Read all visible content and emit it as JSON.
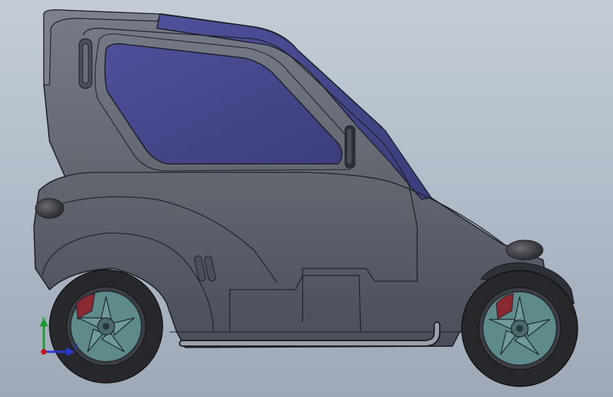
{
  "viewport": {
    "model": "electric-microcar-side-view",
    "background": {
      "top": "#c4ccd6",
      "bottom": "#9ea9b8"
    }
  },
  "colors": {
    "body": "#5e626f",
    "body_light": "#777b88",
    "body_dark": "#454955",
    "glass": "#4a4c8c",
    "glass_dark": "#3a3b78",
    "edge": "#1e2028",
    "tire": "#26282c",
    "rim": "#5f8a8c",
    "brake_caliper": "#8a2a30"
  },
  "triad": {
    "axis_y": "Y",
    "axis_z": "Z",
    "color_y": "#1a9a2a",
    "color_z": "#2a3ad0",
    "color_x": "#c01818"
  }
}
